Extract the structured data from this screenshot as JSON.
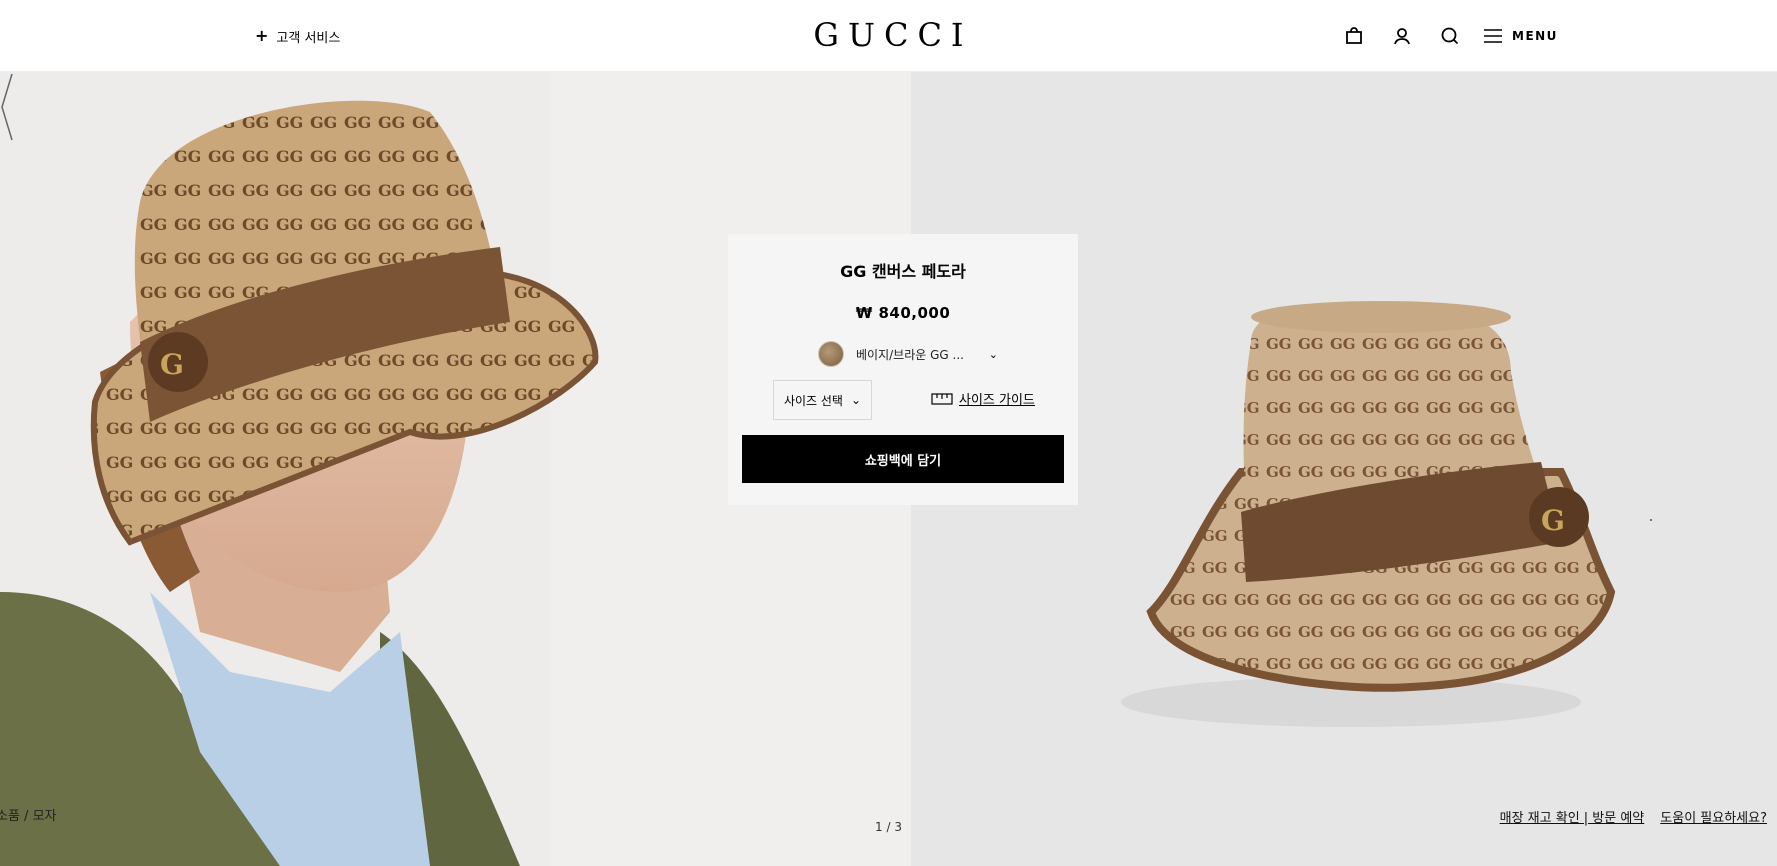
{
  "header": {
    "customer_service": "고객 서비스",
    "logo": "GUCCI",
    "menu_label": "MENU",
    "icons": [
      "shopping-bag-icon",
      "account-icon",
      "search-icon",
      "menu-icon"
    ]
  },
  "product": {
    "name": "GG 캔버스 페도라",
    "price": "₩ 840,000",
    "color": "베이지/브라운 GG ...",
    "size_select": "사이즈 선택",
    "size_guide": "사이즈 가이드",
    "add_to_bag": "쇼핑백에 담기"
  },
  "gallery": {
    "breadcrumb": "소품 / 모자",
    "pager": "1 / 3"
  },
  "footer_links": {
    "store_stock": "매장 재고 확인 | 방문 예약",
    "help": "도움이 필요하세요?"
  },
  "colors": {
    "left_bg": "#edeceb",
    "right_bg": "#e6e6e6",
    "card_bg": "#f5f5f5",
    "button_bg": "#000000"
  }
}
